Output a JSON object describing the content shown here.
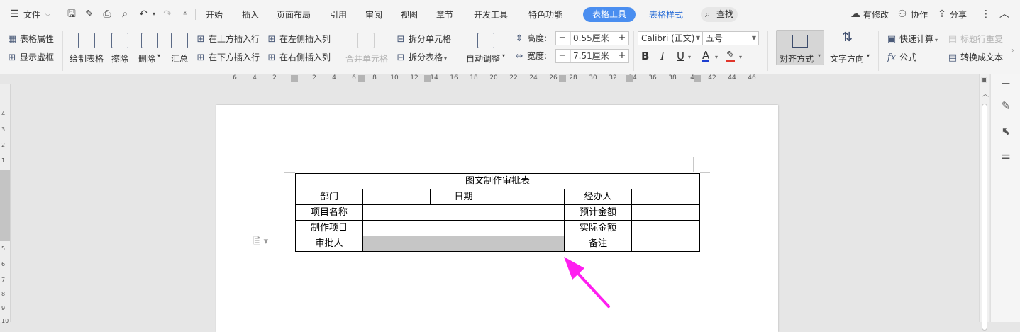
{
  "menubar": {
    "file_label": "文件",
    "tabs": [
      "开始",
      "插入",
      "页面布局",
      "引用",
      "审阅",
      "视图",
      "章节",
      "开发工具",
      "特色功能"
    ],
    "active_tab": "表格工具",
    "style_tab": "表格样式",
    "search_label": "查找",
    "right": {
      "modified": "有修改",
      "collab": "协作",
      "share": "分享"
    }
  },
  "ribbon": {
    "table_props": "表格属性",
    "show_gridlines": "显示虚框",
    "draw_table": "绘制表格",
    "erase": "擦除",
    "delete": "删除",
    "summary": "汇总",
    "insert_above": "在上方插入行",
    "insert_below": "在下方插入行",
    "insert_left": "在左侧插入列",
    "insert_right": "在右侧插入列",
    "merge_cells": "合并单元格",
    "split_cells": "拆分单元格",
    "split_table": "拆分表格",
    "auto_fit": "自动调整",
    "height_label": "高度:",
    "height_value": "0.55厘米",
    "width_label": "宽度:",
    "width_value": "7.51厘米",
    "font_name": "Calibri (正文)",
    "font_size": "五号",
    "align": "对齐方式",
    "text_direction": "文字方向",
    "quick_calc": "快速计算",
    "repeat_header": "标题行重复",
    "formula": "公式",
    "to_text": "转换成文本"
  },
  "ruler": {
    "h_numbers": [
      "6",
      "4",
      "2",
      "2",
      "4",
      "6",
      "8",
      "10",
      "12",
      "14",
      "16",
      "18",
      "20",
      "22",
      "24",
      "26",
      "28",
      "30",
      "32",
      "34",
      "36",
      "38",
      "4",
      "42",
      "44",
      "46"
    ],
    "v_numbers": [
      "4",
      "3",
      "2",
      "1",
      "5",
      "6",
      "7",
      "8",
      "9",
      "10"
    ]
  },
  "document": {
    "table": {
      "title": "图文制作审批表",
      "rows": [
        [
          "部门",
          "",
          "日期",
          "",
          "经办人",
          ""
        ],
        [
          "项目名称",
          "",
          "预计金额",
          ""
        ],
        [
          "制作项目",
          "",
          "实际金额",
          ""
        ],
        [
          "审批人",
          "",
          "备注",
          ""
        ]
      ]
    }
  },
  "colors": {
    "accent": "#4a8ef0",
    "highlight_arrow": "#ff1ef0",
    "selected_cell": "#c6c6c6"
  },
  "icons": {
    "menu": "hamburger-icon",
    "save": "save-icon",
    "print": "print-icon",
    "undo": "undo-icon",
    "redo": "redo-icon",
    "search": "search-icon",
    "collapse": "chevron-up-icon"
  }
}
